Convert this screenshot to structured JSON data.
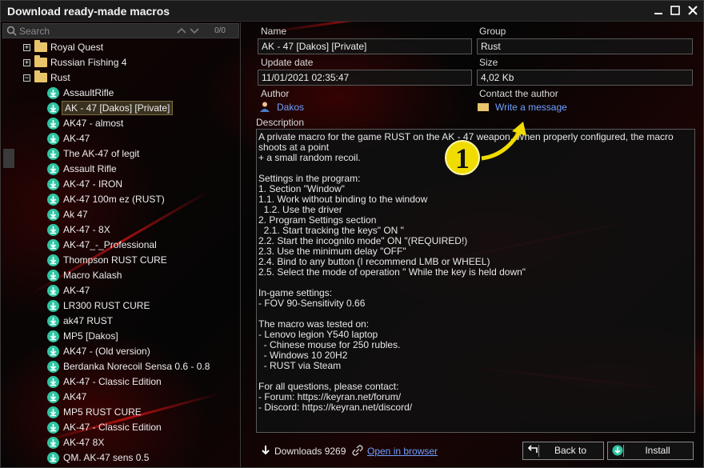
{
  "window": {
    "title": "Download ready-made macros",
    "controls": [
      "close-icon",
      "maximize-icon",
      "minimize-icon"
    ]
  },
  "search": {
    "placeholder": "Search",
    "count": "0/0"
  },
  "tree": {
    "groups": [
      {
        "label": "Royal Quest",
        "expanded": false
      },
      {
        "label": "Russian Fishing 4",
        "expanded": false
      },
      {
        "label": "Rust",
        "expanded": true
      }
    ],
    "items": [
      "AssaultRifle",
      "AK - 47 [Dakos] [Private]",
      "AK47 - almost",
      "AK-47",
      "The AK-47 of legit",
      "Assault Rifle",
      "AK-47 - IRON",
      "AK-47 100m ez (RUST)",
      "Ak 47",
      "AK-47 - 8X",
      "AK-47_-_Professional",
      "Thompson RUST CURE",
      "Macro Kalash",
      "AK-47",
      "LR300 RUST CURE",
      "ak47 RUST",
      "MP5 [Dakos]",
      "AK47 - (Old version)",
      "Berdanka Norecoil Sensa 0.6 - 0.8",
      "AK-47 - Classic Edition",
      "AK47",
      "MP5 RUST CURE",
      "AK-47 - Classic Edition",
      "AK-47 8X",
      "QM. AK-47 sens 0.5"
    ],
    "selected_index": 1
  },
  "details": {
    "name_label": "Name",
    "name_value": "AK - 47 [Dakos] [Private]",
    "group_label": "Group",
    "group_value": "Rust",
    "date_label": "Update date",
    "date_value": "11/01/2021 02:35:47",
    "size_label": "Size",
    "size_value": "4,02 Kb",
    "author_label": "Author",
    "author_value": "Dakos",
    "contact_label": "Contact the author",
    "contact_link": "Write a message",
    "description_label": "Description",
    "description_text": "A private macro for the game RUST on the AK - 47 weapon. When properly configured, the macro shoots at a point\n+ a small random recoil.\n\nSettings in the program:\n1. Section \"Window\"\n1.1. Work without binding to the window\n  1.2. Use the driver\n2. Program Settings section\n  2.1. Start tracking the keys\" ON \"\n2.2. Start the incognito mode\" ON \"(REQUIRED!)\n2.3. Use the minimum delay \"OFF\"\n2.4. Bind to any button (I recommend LMB or WHEEL)\n2.5. Select the mode of operation \" While the key is held down\"\n\nIn-game settings:\n- FOV 90-Sensitivity 0.66\n\nThe macro was tested on:\n- Lenovo legion Y540 laptop\n  - Chinese mouse for 250 rubles.\n  - Windows 10 20H2\n  - RUST via Steam\n\nFor all questions, please contact:\n- Forum: https://keyran.net/forum/\n- Discord: https://keyran.net/discord/"
  },
  "annotation": {
    "marker": "1"
  },
  "footer": {
    "downloads": "Downloads 9269",
    "open_browser": "Open in browser",
    "back_label": "Back to",
    "install_label": "Install"
  },
  "colors": {
    "link": "#6fa0ff",
    "item_icon": "#2fc4a2",
    "folder": "#e8c56a",
    "badge": "#f0dc00"
  }
}
